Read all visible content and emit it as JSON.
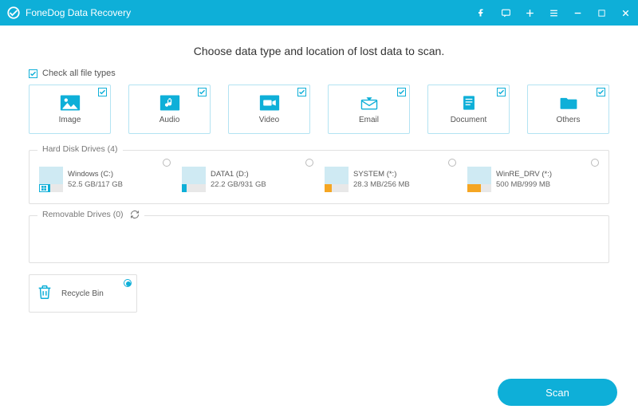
{
  "titlebar": {
    "title": "FoneDog Data Recovery"
  },
  "heading": "Choose data type and location of lost data to scan.",
  "check_all_label": "Check all file types",
  "types": [
    {
      "label": "Image",
      "icon": "image",
      "checked": true
    },
    {
      "label": "Audio",
      "icon": "audio",
      "checked": true
    },
    {
      "label": "Video",
      "icon": "video",
      "checked": true
    },
    {
      "label": "Email",
      "icon": "email",
      "checked": true
    },
    {
      "label": "Document",
      "icon": "document",
      "checked": true
    },
    {
      "label": "Others",
      "icon": "others",
      "checked": true
    }
  ],
  "sections": {
    "hdd": {
      "title": "Hard Disk Drives (4)"
    },
    "removable": {
      "title": "Removable Drives (0)"
    }
  },
  "drives": [
    {
      "name": "Windows (C:)",
      "size": "52.5 GB/117 GB",
      "color": "#0eafd8",
      "fill": 0.45,
      "badge": true
    },
    {
      "name": "DATA1 (D:)",
      "size": "22.2 GB/931 GB",
      "color": "#0eafd8",
      "fill": 0.2,
      "badge": false
    },
    {
      "name": "SYSTEM (*:)",
      "size": "28.3 MB/256 MB",
      "color": "#f5a623",
      "fill": 0.3,
      "badge": false
    },
    {
      "name": "WinRE_DRV (*:)",
      "size": "500 MB/999 MB",
      "color": "#f5a623",
      "fill": 0.55,
      "badge": false
    }
  ],
  "recycle": {
    "label": "Recycle Bin"
  },
  "scan_label": "Scan",
  "colors": {
    "accent": "#0eafd8"
  }
}
